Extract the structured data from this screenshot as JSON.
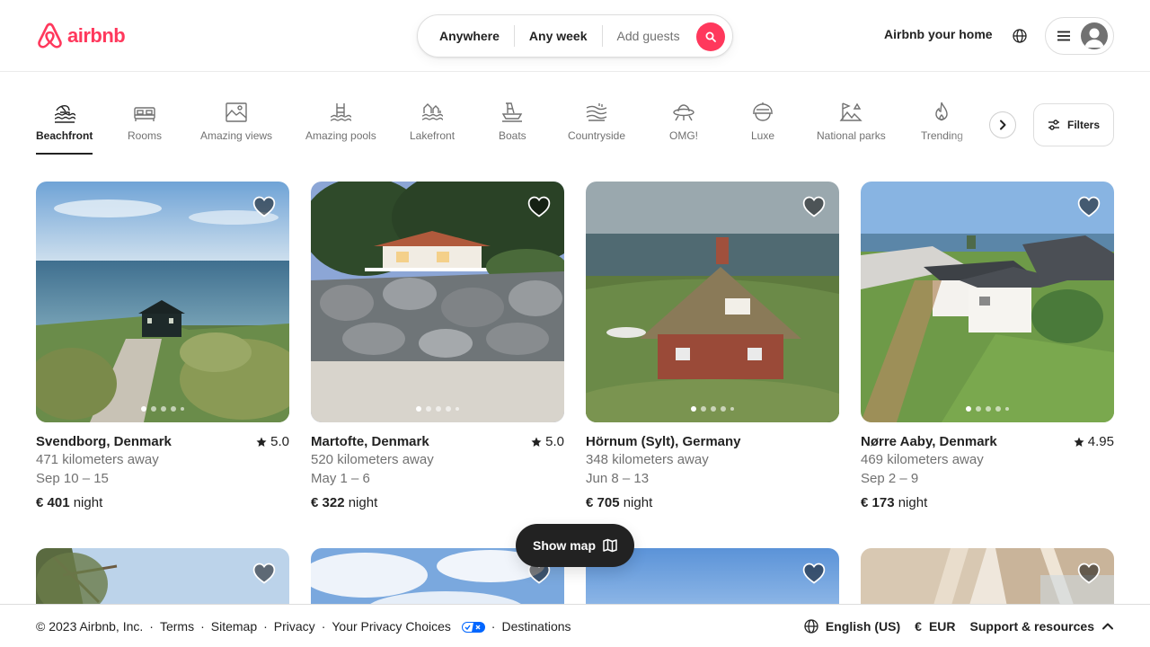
{
  "brand": {
    "name": "airbnb",
    "color": "#ff385c"
  },
  "search": {
    "where": "Anywhere",
    "when": "Any week",
    "guests_placeholder": "Add guests"
  },
  "header": {
    "host_link": "Airbnb your home"
  },
  "categories": [
    {
      "label": "Beachfront",
      "icon": "beachfront-icon",
      "active": true
    },
    {
      "label": "Rooms",
      "icon": "bed-icon"
    },
    {
      "label": "Amazing views",
      "icon": "landscape-icon"
    },
    {
      "label": "Amazing pools",
      "icon": "pool-icon"
    },
    {
      "label": "Lakefront",
      "icon": "lakefront-icon"
    },
    {
      "label": "Boats",
      "icon": "boat-icon"
    },
    {
      "label": "Countryside",
      "icon": "countryside-icon"
    },
    {
      "label": "OMG!",
      "icon": "ufo-icon"
    },
    {
      "label": "Luxe",
      "icon": "luxe-icon"
    },
    {
      "label": "National parks",
      "icon": "national-park-icon"
    },
    {
      "label": "Trending",
      "icon": "flame-icon"
    }
  ],
  "filters": {
    "label": "Filters"
  },
  "listings": [
    {
      "location": "Svendborg, Denmark",
      "rating": "5.0",
      "distance": "471 kilometers away",
      "dates": "Sep 10 – 15",
      "price": "€ 401",
      "price_unit": "night"
    },
    {
      "location": "Martofte, Denmark",
      "rating": "5.0",
      "distance": "520 kilometers away",
      "dates": "May 1 – 6",
      "price": "€ 322",
      "price_unit": "night"
    },
    {
      "location": "Hörnum (Sylt), Germany",
      "rating": "",
      "distance": "348 kilometers away",
      "dates": "Jun 8 – 13",
      "price": "€ 705",
      "price_unit": "night"
    },
    {
      "location": "Nørre Aaby, Denmark",
      "rating": "4.95",
      "distance": "469 kilometers away",
      "dates": "Sep 2 – 9",
      "price": "€ 173",
      "price_unit": "night"
    }
  ],
  "show_map": {
    "label": "Show map"
  },
  "footer": {
    "copyright": "© 2023 Airbnb, Inc.",
    "links": [
      "Terms",
      "Sitemap",
      "Privacy",
      "Your Privacy Choices",
      "Destinations"
    ],
    "language": "English (US)",
    "currency_symbol": "€",
    "currency": "EUR",
    "support": "Support & resources"
  }
}
